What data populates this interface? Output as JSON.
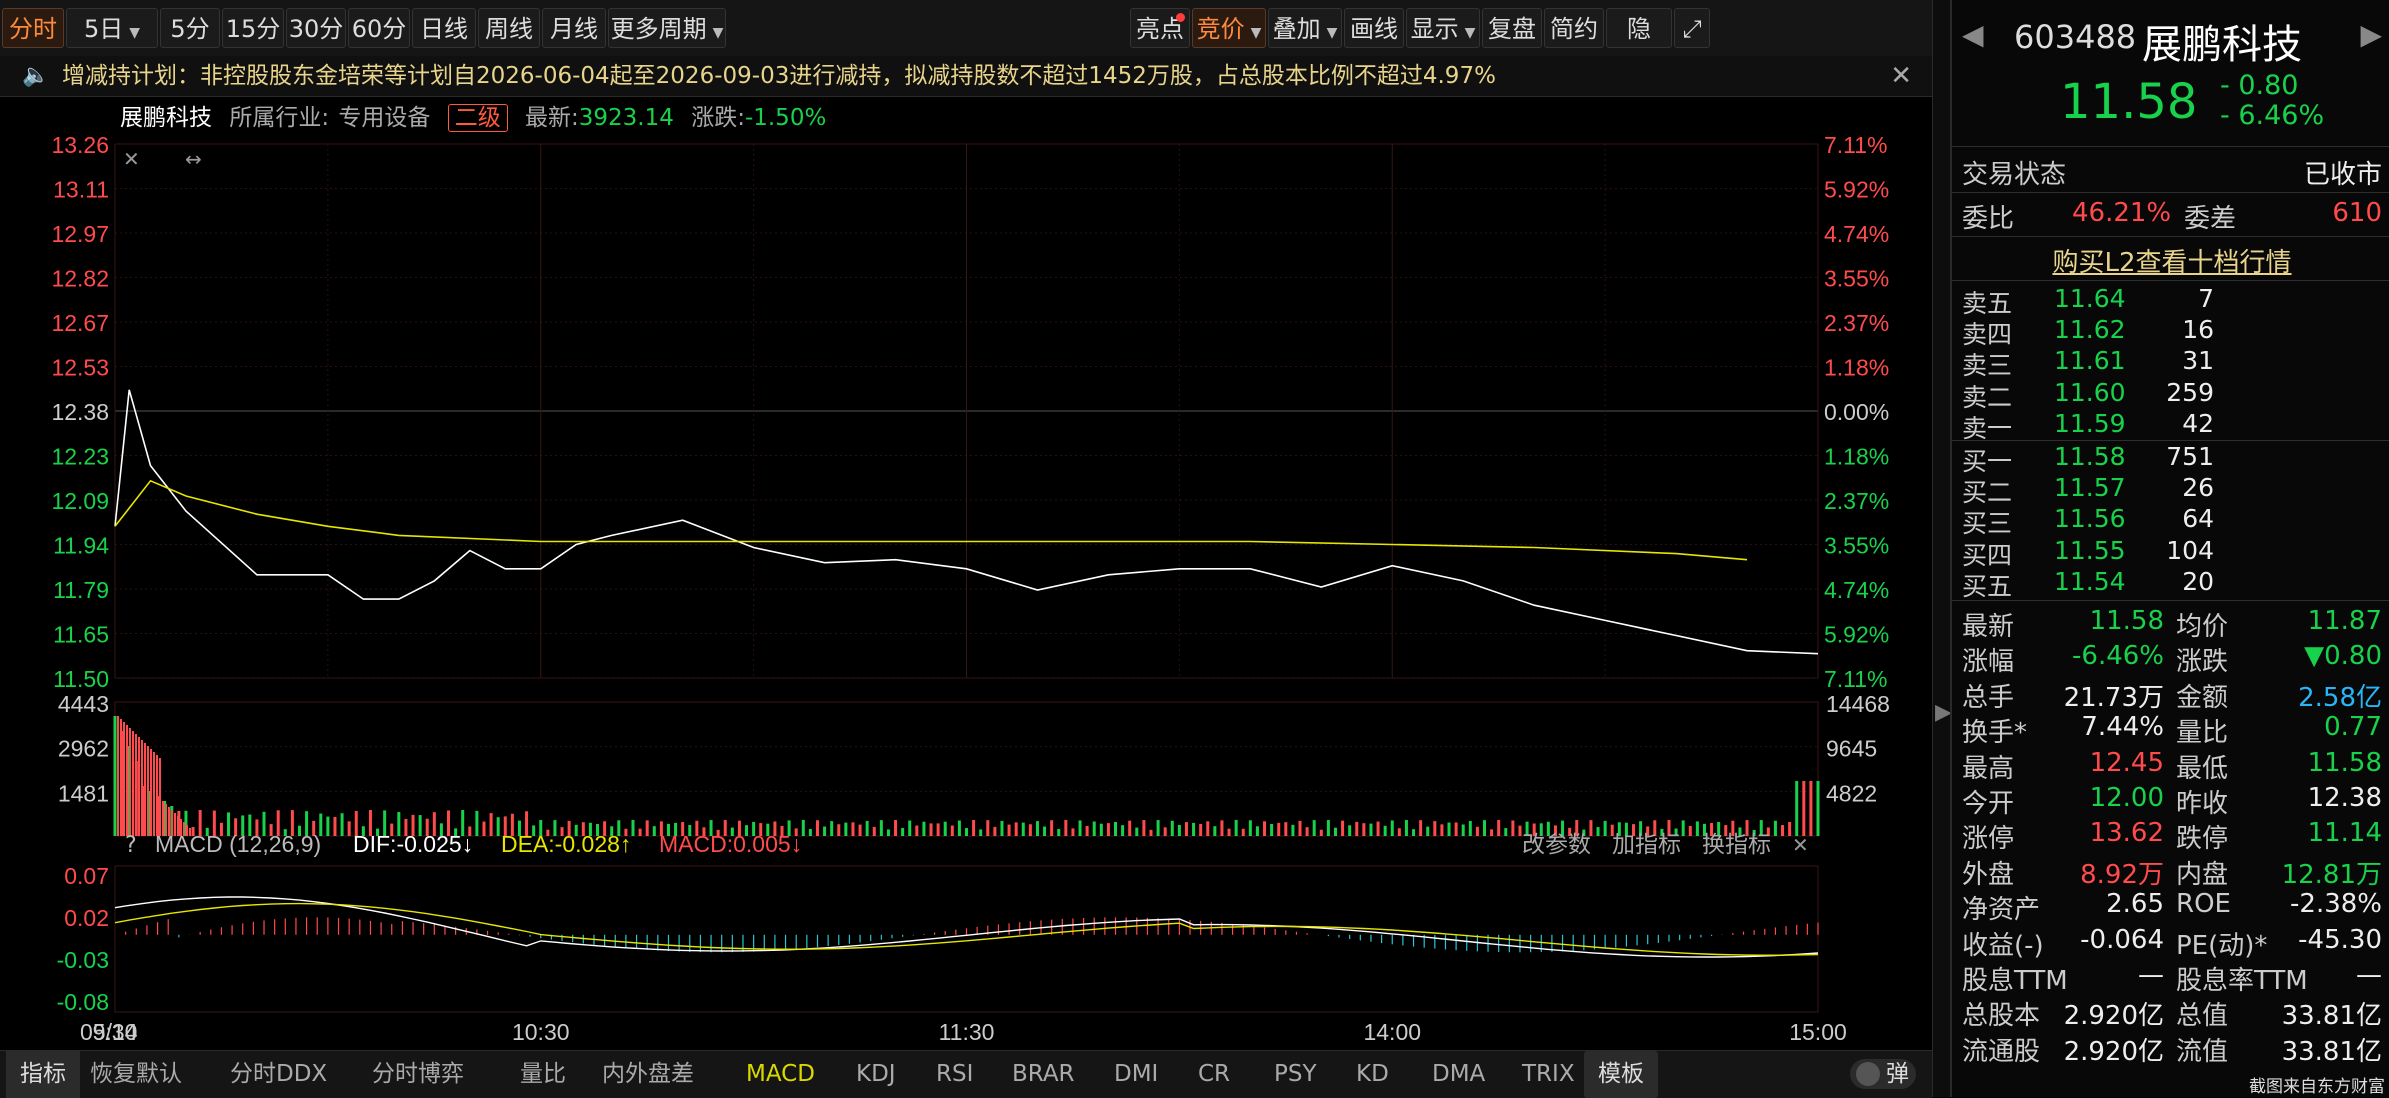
{
  "toolbar": {
    "tabs": [
      {
        "label": "分时",
        "active": true
      },
      {
        "label": "5日",
        "dropdown": true
      },
      {
        "label": "5分钟"
      },
      {
        "label": "15分钟"
      },
      {
        "label": "30分钟"
      },
      {
        "label": "60分钟"
      },
      {
        "label": "日线"
      },
      {
        "label": "周线"
      },
      {
        "label": "月线"
      },
      {
        "label": "更多周期",
        "dropdown": true
      }
    ],
    "right_buttons": [
      {
        "label": "亮点",
        "dot": true
      },
      {
        "label": "竞价",
        "dropdown": true,
        "active": true
      },
      {
        "label": "叠加",
        "dropdown": true
      },
      {
        "label": "画线"
      },
      {
        "label": "显示",
        "dropdown": true
      },
      {
        "label": "复盘"
      },
      {
        "label": "简约"
      },
      {
        "label": "隐藏",
        "suffix": "»"
      }
    ],
    "fullscreen_icon": "expand-icon"
  },
  "notice": {
    "text": "增减持计划：非控股股东金培荣等计划自2026-06-04起至2026-09-03进行减持，拟减持股数不超过1452万股，占总股本比例不超过4.97%",
    "icon": "speaker-icon"
  },
  "info": {
    "name": "展鹏科技",
    "industry_label": "所属行业:",
    "industry": "专用设备",
    "level_badge": "二级",
    "latest_label": "最新:",
    "latest": "3923.14",
    "change_label": "涨跌:",
    "change": "-1.50%"
  },
  "chart_data": {
    "type": "line",
    "date_label": "05/14",
    "x_ticks": [
      "9:30",
      "10:30",
      "11:30",
      "14:00",
      "15:00"
    ],
    "price_ticks": [
      "13.26",
      "13.11",
      "12.97",
      "12.82",
      "12.67",
      "12.53",
      "12.38",
      "12.23",
      "12.09",
      "11.94",
      "11.79",
      "11.65",
      "11.50"
    ],
    "pct_ticks": [
      "7.11%",
      "5.92%",
      "4.74%",
      "3.55%",
      "2.37%",
      "1.18%",
      "0.00%",
      "1.18%",
      "2.37%",
      "3.55%",
      "4.74%",
      "5.92%",
      "7.11%"
    ],
    "ylim": [
      11.5,
      13.26
    ],
    "prev_close": 12.38,
    "series": [
      {
        "name": "价格",
        "color": "#ffffff",
        "x": [
          0,
          2,
          5,
          10,
          20,
          30,
          35,
          40,
          45,
          50,
          55,
          60,
          65,
          70,
          80,
          90,
          100,
          110,
          120,
          130,
          140,
          150,
          160,
          170,
          180,
          190,
          200,
          210,
          220,
          230,
          240
        ],
        "values": [
          12.0,
          12.45,
          12.2,
          12.05,
          11.84,
          11.84,
          11.76,
          11.76,
          11.82,
          11.92,
          11.86,
          11.86,
          11.94,
          11.97,
          12.02,
          11.93,
          11.88,
          11.89,
          11.86,
          11.79,
          11.84,
          11.86,
          11.86,
          11.8,
          11.87,
          11.82,
          11.74,
          11.69,
          11.64,
          11.59,
          11.58
        ]
      },
      {
        "name": "均价",
        "color": "#e6e600",
        "x": [
          0,
          5,
          10,
          20,
          30,
          40,
          60,
          80,
          100,
          120,
          140,
          160,
          180,
          200,
          220,
          230
        ],
        "values": [
          12.0,
          12.15,
          12.1,
          12.04,
          12.0,
          11.97,
          11.95,
          11.95,
          11.95,
          11.95,
          11.95,
          11.95,
          11.94,
          11.93,
          11.91,
          11.89
        ]
      }
    ],
    "volume": {
      "ticks_left": [
        "4443",
        "2962",
        "1481"
      ],
      "ticks_right": [
        "14468",
        "9645",
        "4822"
      ]
    },
    "macd": {
      "title": "MACD (12,26,9)",
      "dif": "DIF:-0.025↓",
      "dea": "DEA:-0.028↑",
      "macd": "MACD:0.005↓",
      "ticks": [
        "0.07",
        "0.02",
        "-0.03",
        "-0.08"
      ],
      "buttons": [
        "改参数",
        "加指标",
        "换指标"
      ]
    }
  },
  "bottom_bar": {
    "items": [
      "指标",
      "恢复默认",
      "分时DDX",
      "分时博弈",
      "量比",
      "内外盘差",
      "MACD",
      "KDJ",
      "RSI",
      "BRAR",
      "DMI",
      "CR",
      "PSY",
      "KD",
      "DMA",
      "TRIX"
    ],
    "active": "MACD",
    "template_btn": "模板",
    "toggle_label": "弹"
  },
  "quote": {
    "code": "603488",
    "name": "展鹏科技",
    "price": "11.58",
    "change": "- 0.80",
    "change_pct": "- 6.46%",
    "trade_status_label": "交易状态",
    "trade_status": "已收市",
    "weibi_label": "委比",
    "weibi": "46.21%",
    "weicha_label": "委差",
    "weicha": "610",
    "l2_link": "购买L2查看十档行情",
    "asks": [
      {
        "label": "卖五",
        "price": "11.64",
        "vol": "7"
      },
      {
        "label": "卖四",
        "price": "11.62",
        "vol": "16"
      },
      {
        "label": "卖三",
        "price": "11.61",
        "vol": "31"
      },
      {
        "label": "卖二",
        "price": "11.60",
        "vol": "259"
      },
      {
        "label": "卖一",
        "price": "11.59",
        "vol": "42"
      }
    ],
    "bids": [
      {
        "label": "买一",
        "price": "11.58",
        "vol": "751"
      },
      {
        "label": "买二",
        "price": "11.57",
        "vol": "26"
      },
      {
        "label": "买三",
        "price": "11.56",
        "vol": "64"
      },
      {
        "label": "买四",
        "price": "11.55",
        "vol": "104"
      },
      {
        "label": "买五",
        "price": "11.54",
        "vol": "20"
      }
    ],
    "stats": [
      {
        "l1": "最新",
        "v1": "11.58",
        "c1": "green",
        "l2": "均价",
        "v2": "11.87",
        "c2": "green"
      },
      {
        "l1": "涨幅",
        "v1": "-6.46%",
        "c1": "green",
        "l2": "涨跌",
        "v2": "▼0.80",
        "c2": "green"
      },
      {
        "l1": "总手",
        "v1": "21.73万",
        "c1": "white",
        "l2": "金额",
        "v2": "2.58亿",
        "c2": "cyan"
      },
      {
        "l1": "换手*",
        "v1": "7.44%",
        "c1": "white",
        "l2": "量比",
        "v2": "0.77",
        "c2": "green"
      },
      {
        "l1": "最高",
        "v1": "12.45",
        "c1": "red",
        "l2": "最低",
        "v2": "11.58",
        "c2": "green"
      },
      {
        "l1": "今开",
        "v1": "12.00",
        "c1": "green",
        "l2": "昨收",
        "v2": "12.38",
        "c2": "white"
      },
      {
        "l1": "涨停",
        "v1": "13.62",
        "c1": "red",
        "l2": "跌停",
        "v2": "11.14",
        "c2": "green"
      },
      {
        "l1": "外盘",
        "v1": "8.92万",
        "c1": "red",
        "l2": "内盘",
        "v2": "12.81万",
        "c2": "green"
      },
      {
        "l1": "净资产",
        "v1": "2.65",
        "c1": "white",
        "l2": "ROE",
        "v2": "-2.38%",
        "c2": "white"
      },
      {
        "l1": "收益(-)",
        "v1": "-0.064",
        "c1": "white",
        "l2": "PE(动)*",
        "v2": "-45.30",
        "c2": "white"
      },
      {
        "l1": "股息TTM",
        "v1": "—",
        "c1": "white",
        "l2": "股息率TTM",
        "v2": "—",
        "c2": "white"
      },
      {
        "l1": "总股本",
        "v1": "2.920亿",
        "c1": "white",
        "l2": "总值",
        "v2": "33.81亿",
        "c2": "white"
      },
      {
        "l1": "流通股",
        "v1": "2.920亿",
        "c1": "white",
        "l2": "流值",
        "v2": "33.81亿",
        "c2": "white"
      }
    ],
    "footer": "截图来自东方财富"
  }
}
